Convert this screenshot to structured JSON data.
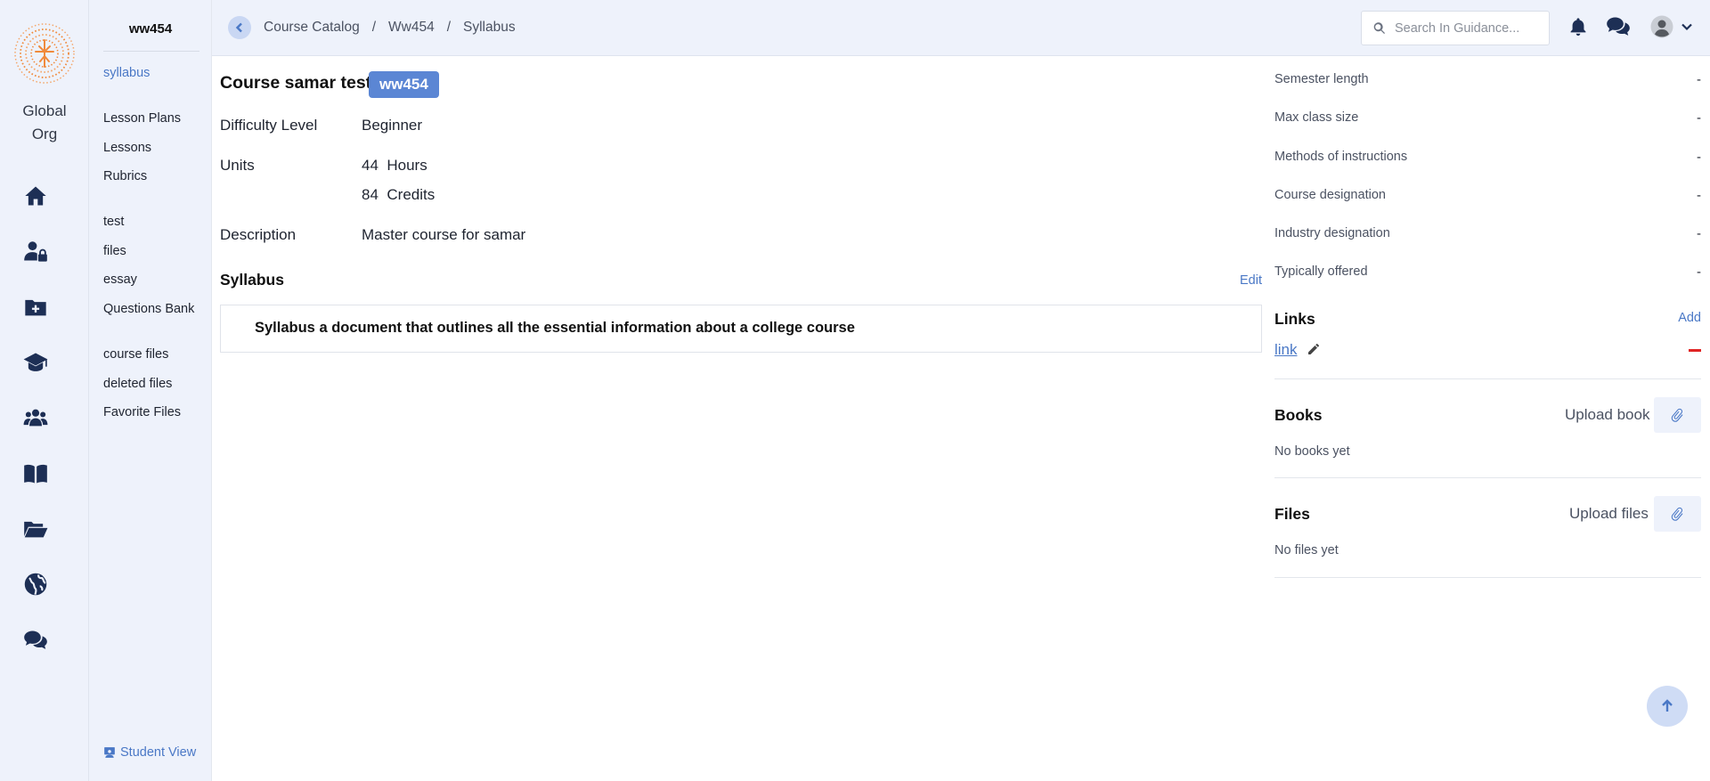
{
  "org": {
    "name_line1": "Global",
    "name_line2": "Org"
  },
  "subnav": {
    "title": "ww454",
    "items": [
      {
        "label": "syllabus",
        "active": true
      },
      {
        "label": "Lesson Plans"
      },
      {
        "label": "Lessons"
      },
      {
        "label": "Rubrics"
      },
      {
        "label": "test"
      },
      {
        "label": "files"
      },
      {
        "label": "essay"
      },
      {
        "label": "Questions Bank"
      },
      {
        "label": "course files"
      },
      {
        "label": "deleted files"
      },
      {
        "label": "Favorite Files"
      }
    ],
    "student_view": "Student View"
  },
  "header": {
    "breadcrumbs": [
      "Course Catalog",
      "Ww454",
      "Syllabus"
    ],
    "separator": "/",
    "search_placeholder": "Search In Guidance..."
  },
  "course": {
    "title": "Course samar test",
    "code": "ww454",
    "difficulty_label": "Difficulty Level",
    "difficulty_value": "Beginner",
    "units_label": "Units",
    "hours_value": "44",
    "hours_unit": "Hours",
    "credits_value": "84",
    "credits_unit": "Credits",
    "description_label": "Description",
    "description_value": "Master course for samar",
    "syllabus_title": "Syllabus",
    "edit_label": "Edit",
    "syllabus_text": "Syllabus a document that outlines all the essential information about a college course"
  },
  "side": {
    "meta": [
      {
        "label": "Semester length",
        "value": "-"
      },
      {
        "label": "Max class size",
        "value": "-"
      },
      {
        "label": "Methods of instructions",
        "value": "-"
      },
      {
        "label": "Course designation",
        "value": "-"
      },
      {
        "label": "Industry designation",
        "value": "-"
      },
      {
        "label": "Typically offered",
        "value": "-"
      }
    ],
    "links_title": "Links",
    "links_add": "Add",
    "link_text": "link",
    "books_title": "Books",
    "books_upload": "Upload book",
    "books_empty": "No books yet",
    "files_title": "Files",
    "files_upload": "Upload files",
    "files_empty": "No files yet"
  },
  "colors": {
    "accent": "#4a78c6",
    "badge": "#5b86d4",
    "rail": "#eef2fb",
    "icon": "#1d2f55",
    "danger": "#e02424"
  }
}
